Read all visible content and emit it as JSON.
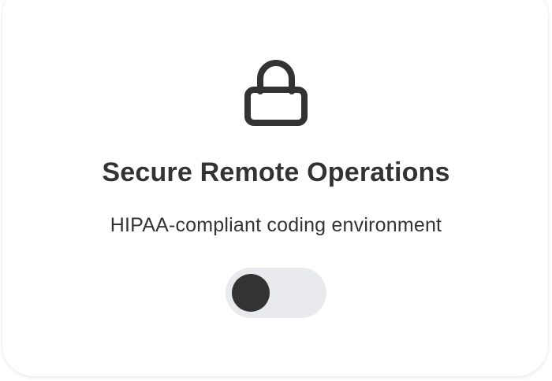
{
  "card": {
    "icon": "lock-icon",
    "title": "Secure Remote Operations",
    "subtitle": "HIPAA-compliant coding environment",
    "toggle": {
      "state": "off"
    }
  },
  "colors": {
    "text": "#333333",
    "toggle_track": "#e9eaee",
    "toggle_knob": "#333333",
    "background": "#ffffff"
  }
}
